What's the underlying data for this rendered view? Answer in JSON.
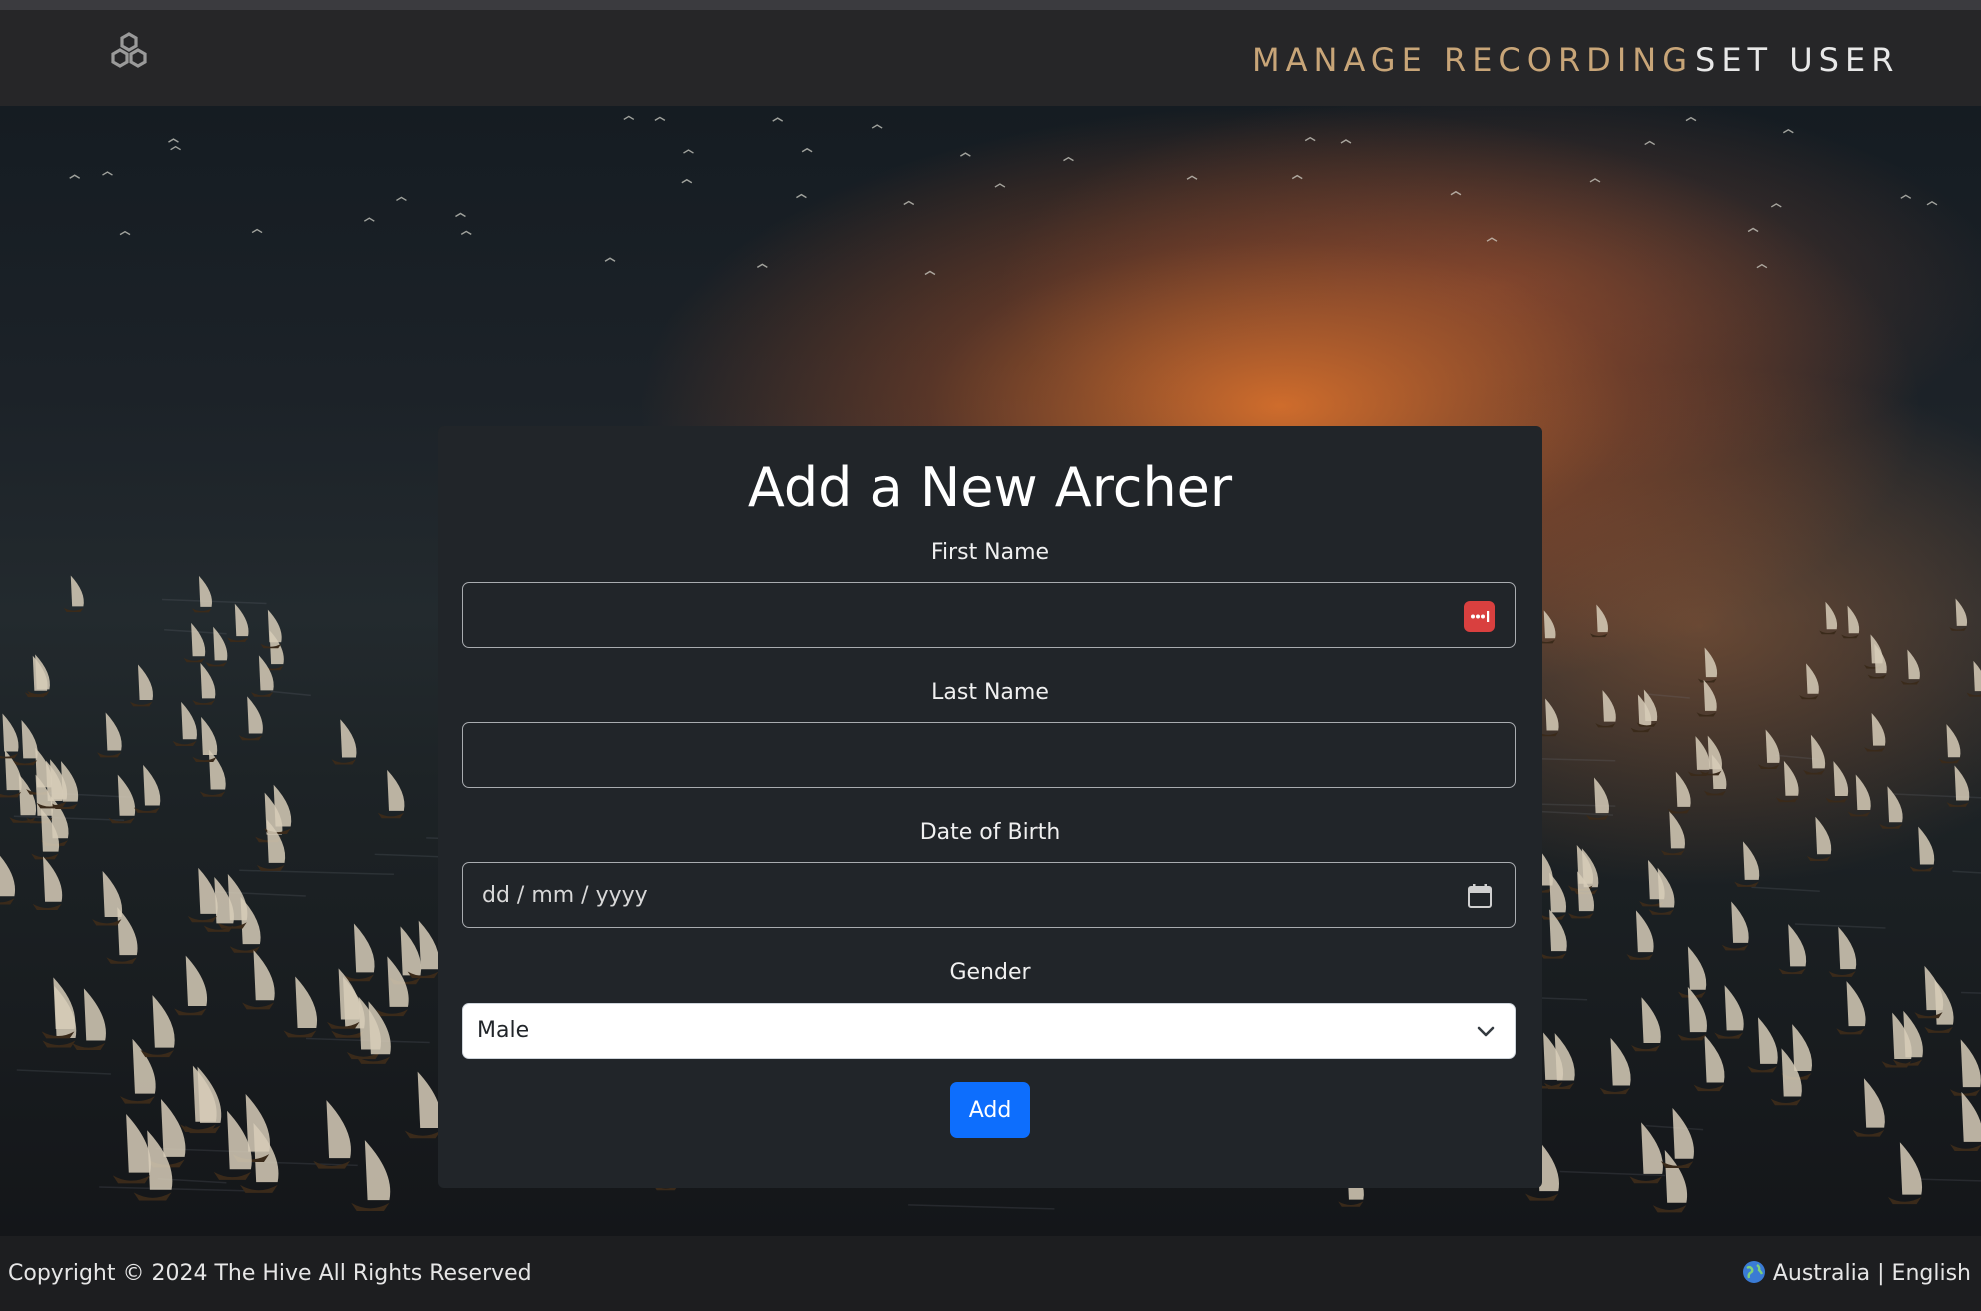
{
  "navbar": {
    "logo_icon": "hexagon-cluster-icon",
    "links": [
      "MANAGE RECORDING",
      "SET USER"
    ],
    "active_color": "#c8a578"
  },
  "form": {
    "title": "Add a New Archer",
    "first_name": {
      "label": "First Name",
      "value": "",
      "icon": "password-manager-icon"
    },
    "last_name": {
      "label": "Last Name",
      "value": ""
    },
    "dob": {
      "label": "Date of Birth",
      "placeholder": "dd / mm / yyyy",
      "icon": "calendar-icon"
    },
    "gender": {
      "label": "Gender",
      "selected": "Male",
      "icon": "chevron-down-icon"
    },
    "submit_label": "Add",
    "submit_color": "#0d6efd"
  },
  "footer": {
    "copyright": "Copyright © 2024 The Hive All Rights Reserved",
    "locale": "Australia | English",
    "locale_icon": "globe-icon"
  }
}
